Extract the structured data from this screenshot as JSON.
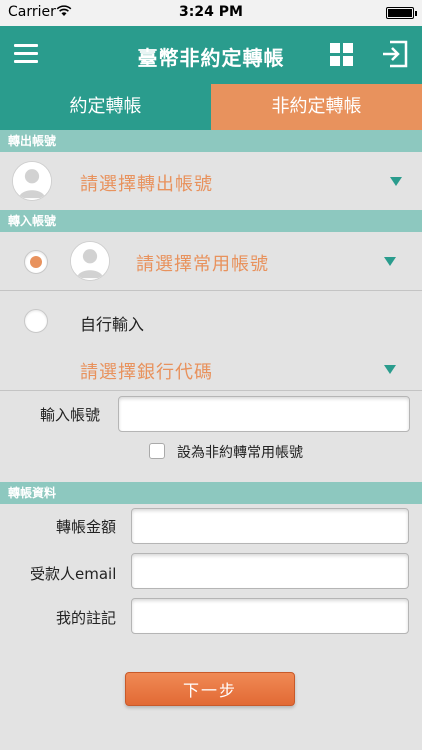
{
  "status_bar": {
    "carrier": "Carrier",
    "time": "3:24 PM"
  },
  "nav": {
    "title": "臺幣非約定轉帳"
  },
  "tabs": [
    {
      "label": "約定轉帳",
      "selected": false
    },
    {
      "label": "非約定轉帳",
      "selected": true
    }
  ],
  "sections": {
    "from_account": "轉出帳號",
    "to_account": "轉入帳號",
    "transfer_info": "轉帳資料"
  },
  "from_account": {
    "placeholder": "請選擇轉出帳號"
  },
  "to_account": {
    "common_placeholder": "請選擇常用帳號",
    "manual_label": "自行輸入",
    "bank_placeholder": "請選擇銀行代碼",
    "account_label": "輸入帳號",
    "account_value": "",
    "save_common_label": "設為非約轉常用帳號"
  },
  "transfer": {
    "amount_label": "轉帳金額",
    "amount_value": "",
    "email_label": "受款人email",
    "email_value": "",
    "note_label": "我的註記",
    "note_value": ""
  },
  "next_button": "下一步",
  "colors": {
    "teal": "#2a9c8d",
    "orange": "#e8925d",
    "section_header": "#8dc8bf"
  }
}
